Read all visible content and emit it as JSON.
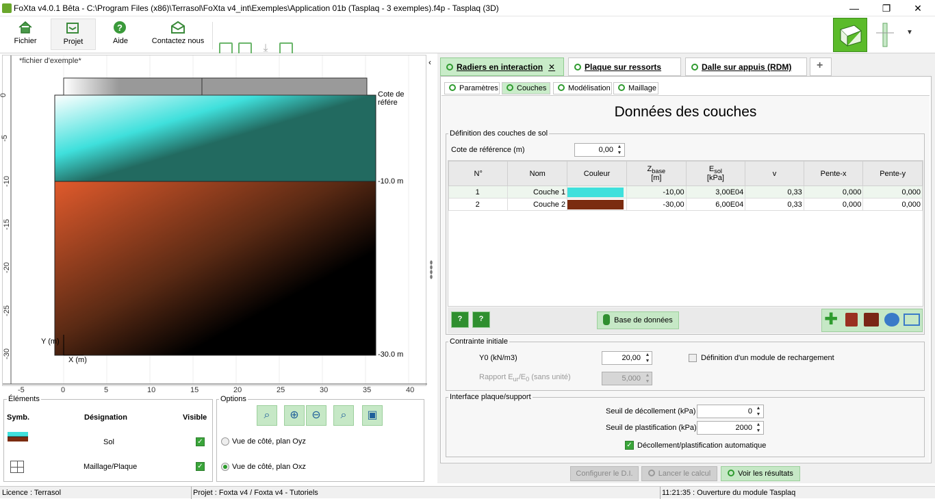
{
  "window": {
    "title": "FoXta v4.0.1 Bêta - C:\\Program Files (x86)\\Terrasol\\FoXta v4_int\\Exemples\\Application 01b (Tasplaq - 3 exemples).f4p - Tasplaq (3D)"
  },
  "toolbar": {
    "fichier": "Fichier",
    "projet": "Projet",
    "aide": "Aide",
    "contact": "Contactez nous"
  },
  "plot": {
    "file_note": "*fichier d'exemple*",
    "ref_label": "Cote de référe",
    "level_10": "-10.0 m",
    "level_30": "-30.0 m",
    "y_axis_label": "Y (m)",
    "x_axis_label": "X (m)",
    "x_ticks": [
      "-5",
      "0",
      "5",
      "10",
      "15",
      "20",
      "25",
      "30",
      "35",
      "40"
    ],
    "y_ticks": [
      "0",
      "-5",
      "-10",
      "-15",
      "-20",
      "-25",
      "-30"
    ]
  },
  "elements": {
    "title": "Éléments",
    "col_symb": "Symb.",
    "col_desig": "Désignation",
    "col_visible": "Visible",
    "rows": [
      {
        "name": "Sol"
      },
      {
        "name": "Maillage/Plaque"
      }
    ]
  },
  "options": {
    "title": "Options",
    "view_oyz": "Vue de côté, plan Oyz",
    "view_oxz": "Vue de côté, plan Oxz"
  },
  "tabs": [
    {
      "label": "Radiers en interaction"
    },
    {
      "label": "Plaque sur ressorts"
    },
    {
      "label": "Dalle sur appuis (RDM)"
    }
  ],
  "subtabs": [
    {
      "label": "Paramètres"
    },
    {
      "label": "Couches"
    },
    {
      "label": "Modélisation"
    },
    {
      "label": "Maillage"
    }
  ],
  "couches": {
    "title": "Données des couches",
    "group_def": "Définition des couches de sol",
    "cote_label": "Cote de référence (m)",
    "cote_value": "0,00",
    "headers": {
      "num": "N°",
      "nom": "Nom",
      "couleur": "Couleur",
      "zbase": "Z",
      "zbase_sub": "base",
      "zbase_unit": "[m]",
      "esol": "E",
      "esol_sub": "sol",
      "esol_unit": "[kPa]",
      "v": "v",
      "pente_x": "Pente-x",
      "pente_y": "Pente-y"
    },
    "rows": [
      {
        "num": "1",
        "nom": "Couche 1",
        "color": "#3fe0dc",
        "zbase": "-10,00",
        "esol": "3,00E04",
        "v": "0,33",
        "px": "0,000",
        "py": "0,000"
      },
      {
        "num": "2",
        "nom": "Couche 2",
        "color": "#7b2c10",
        "zbase": "-30,00",
        "esol": "6,00E04",
        "v": "0,33",
        "px": "0,000",
        "py": "0,000"
      }
    ],
    "db_button": "Base de données"
  },
  "contrainte": {
    "group": "Contrainte initiale",
    "y0_label": "Y0 (kN/m3)",
    "y0_value": "20,00",
    "rech_label": "Définition d'un module de rechargement",
    "rapport_label_a": "Rapport E",
    "rapport_sub1": "ur",
    "rapport_label_b": "/E",
    "rapport_sub2": "0",
    "rapport_label_c": " (sans unité)",
    "rapport_value": "5,000"
  },
  "interface": {
    "group": "Interface plaque/support",
    "decol_label": "Seuil de décollement (kPa)",
    "decol_value": "0",
    "plast_label": "Seuil de plastification (kPa)",
    "plast_value": "2000",
    "auto_label": "Décollement/plastification automatique"
  },
  "actions": {
    "config": "Configurer le D.I.",
    "lancer": "Lancer le calcul",
    "voir": "Voir les résultats"
  },
  "status": {
    "licence": "Licence : Terrasol",
    "projet": "Projet : Foxta v4 / Foxta v4 - Tutoriels",
    "msg": "11:21:35 : Ouverture du module Tasplaq"
  }
}
